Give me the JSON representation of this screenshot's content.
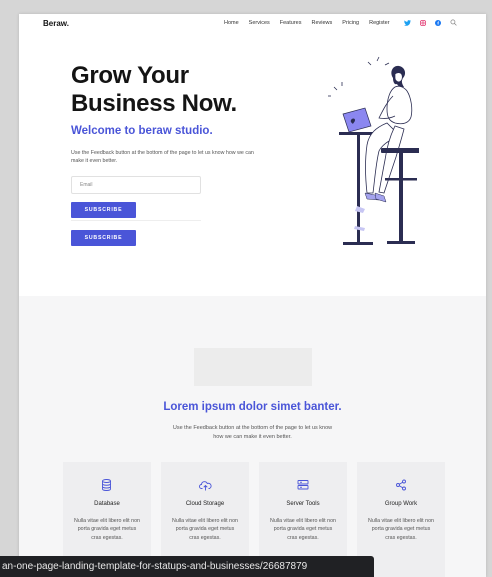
{
  "nav": {
    "logo": "Beraw.",
    "links": [
      "Home",
      "Services",
      "Features",
      "Reviews",
      "Pricing",
      "Register"
    ],
    "icons": [
      "twitter-icon",
      "instagram-icon",
      "facebook-icon",
      "search-icon"
    ]
  },
  "hero": {
    "title_line1": "Grow Your",
    "title_line2": "Business Now.",
    "subtitle": "Welcome to beraw studio.",
    "description": "Use the Feedback button at the bottom of the page to let us know how we can make it even better.",
    "email_placeholder": "Email",
    "button1": "SUBSCRIBE",
    "button2": "SUBSCRIBE"
  },
  "section": {
    "title": "Lorem ipsum dolor simet banter.",
    "description_line1": "Use the Feedback button at the bottom of the page to let us know",
    "description_line2": "how we can make it even better.",
    "cards": [
      {
        "title": "Database",
        "icon": "database-icon",
        "text": "Nulla vitae elit libero elit non porta gravida eget metus cras egestas."
      },
      {
        "title": "Cloud Storage",
        "icon": "cloud-upload-icon",
        "text": "Nulla vitae elit libero elit non porta gravida eget metus cras egestas."
      },
      {
        "title": "Server Tools",
        "icon": "server-icon",
        "text": "Nulla vitae elit libero elit non porta gravida eget metus cras egestas."
      },
      {
        "title": "Group Work",
        "icon": "share-icon",
        "text": "Nulla vitae elit libero elit non porta gravida eget metus cras egestas."
      }
    ]
  },
  "status_url": "an-one-page-landing-template-for-statups-and-businesses/26687879",
  "colors": {
    "accent": "#4a55d8",
    "dark": "#141414",
    "section_bg": "#f6f6f7"
  }
}
